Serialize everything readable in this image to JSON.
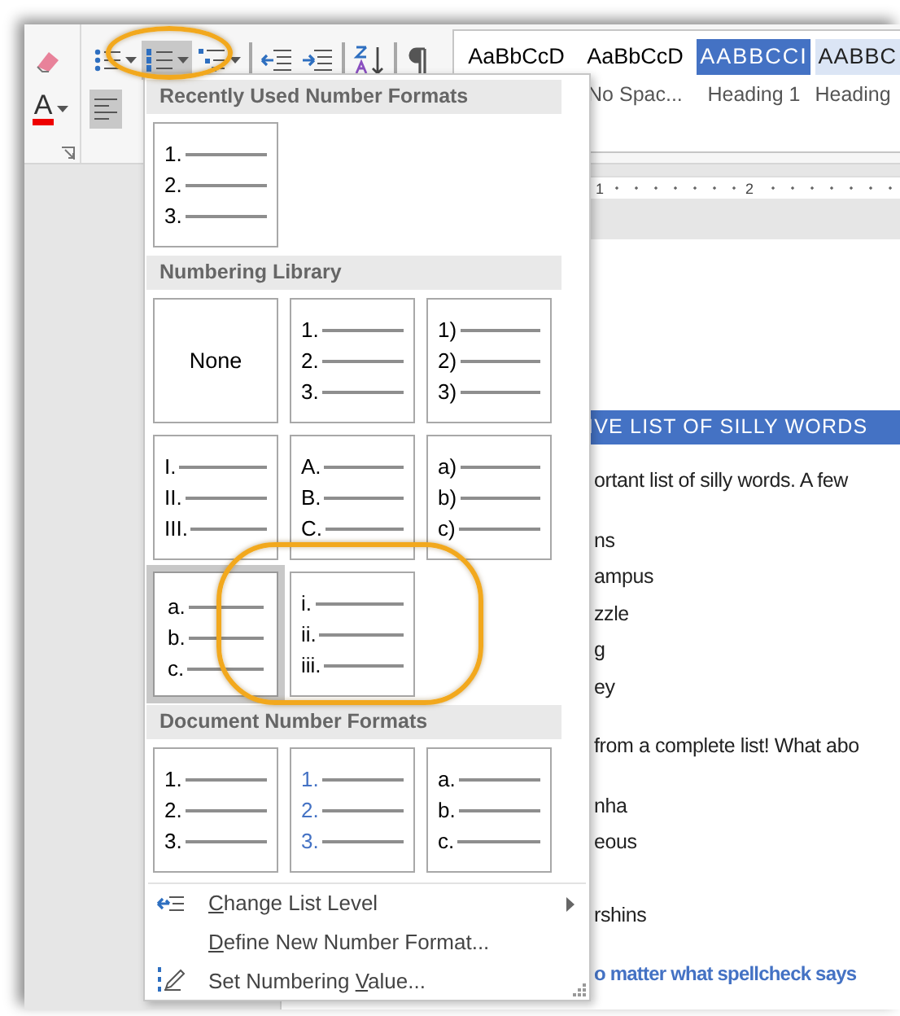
{
  "ribbon": {
    "font_group": [
      {
        "kind": "clear-formatting",
        "selected": false
      },
      {
        "kind": "font-color",
        "glyph": "A",
        "selected": false
      }
    ],
    "paragraph_row1": [
      {
        "kind": "bullets",
        "dropdown": true,
        "selected": false
      },
      {
        "kind": "numbering",
        "dropdown": true,
        "selected": true
      },
      {
        "kind": "multilevel",
        "dropdown": true,
        "selected": false
      },
      {
        "kind": "decrease-indent",
        "separator_before": true,
        "selected": false
      },
      {
        "kind": "increase-indent",
        "selected": false
      },
      {
        "kind": "sort",
        "separator_before": true,
        "selected": false
      },
      {
        "kind": "pilcrow",
        "separator_before": true,
        "selected": false
      }
    ],
    "paragraph_row2": [
      {
        "kind": "align-left",
        "selected": true
      }
    ],
    "styles": [
      {
        "kind": "plain",
        "preview": "AaBbCcD"
      },
      {
        "kind": "plain",
        "preview": "AaBbCcD",
        "label": "No Spac..."
      },
      {
        "kind": "heading1",
        "preview": "AABBCCI",
        "label": "Heading 1"
      },
      {
        "kind": "heading2",
        "preview": "AABBC",
        "label": "Heading"
      }
    ]
  },
  "ruler": {
    "labels": [
      "1",
      "2"
    ]
  },
  "document": {
    "heading": "IVE LIST OF SILLY WORDS",
    "paragraphs": [
      {
        "kind": "body",
        "text": "ortant list of silly words. A few"
      },
      {
        "kind": "item",
        "text": "ns"
      },
      {
        "kind": "item",
        "text": "ampus"
      },
      {
        "kind": "item",
        "text": "zzle"
      },
      {
        "kind": "item",
        "text": "g"
      },
      {
        "kind": "item",
        "text": "ey"
      },
      {
        "kind": "body",
        "text": "from a complete list! What abo"
      },
      {
        "kind": "item",
        "text": "nha"
      },
      {
        "kind": "item",
        "text": "eous"
      },
      {
        "kind": "item",
        "text": "rshins",
        "after_blank": true
      },
      {
        "kind": "emphasis",
        "text": "o matter what spellcheck says"
      }
    ]
  },
  "menu": {
    "sections": [
      {
        "title": "Recently Used Number Formats",
        "tiles": [
          {
            "kind": "list",
            "markers": [
              "1.",
              "2.",
              "3."
            ],
            "selected": false
          }
        ]
      },
      {
        "title": "Numbering Library",
        "tiles": [
          {
            "kind": "none",
            "label": "None",
            "selected": false
          },
          {
            "kind": "list",
            "markers": [
              "1.",
              "2.",
              "3."
            ],
            "selected": false
          },
          {
            "kind": "list",
            "markers": [
              "1)",
              "2)",
              "3)"
            ],
            "selected": false
          },
          {
            "kind": "list",
            "markers": [
              "I.",
              "II.",
              "III."
            ],
            "selected": false
          },
          {
            "kind": "list",
            "markers": [
              "A.",
              "B.",
              "C."
            ],
            "selected": false
          },
          {
            "kind": "list",
            "markers": [
              "a)",
              "b)",
              "c)"
            ],
            "selected": false
          },
          {
            "kind": "list",
            "markers": [
              "a.",
              "b.",
              "c."
            ],
            "selected": true
          },
          {
            "kind": "list",
            "markers": [
              "i.",
              "ii.",
              "iii."
            ],
            "selected": false
          }
        ]
      },
      {
        "title": "Document Number Formats",
        "tiles": [
          {
            "kind": "list",
            "markers": [
              "1.",
              "2.",
              "3."
            ],
            "color": "#000000",
            "selected": false
          },
          {
            "kind": "list",
            "markers": [
              "1.",
              "2.",
              "3."
            ],
            "color": "#4472c4",
            "selected": false
          },
          {
            "kind": "list",
            "markers": [
              "a.",
              "b.",
              "c."
            ],
            "color": "#000000",
            "selected": false
          }
        ]
      }
    ],
    "items": [
      {
        "kind": "change-level",
        "key": "C",
        "after": "hange List Level",
        "submenu": true
      },
      {
        "kind": "plain",
        "key": "D",
        "after": "efine New Number Format..."
      },
      {
        "kind": "set-value",
        "before": "Set Numbering ",
        "key": "V",
        "after": "alue..."
      }
    ]
  }
}
